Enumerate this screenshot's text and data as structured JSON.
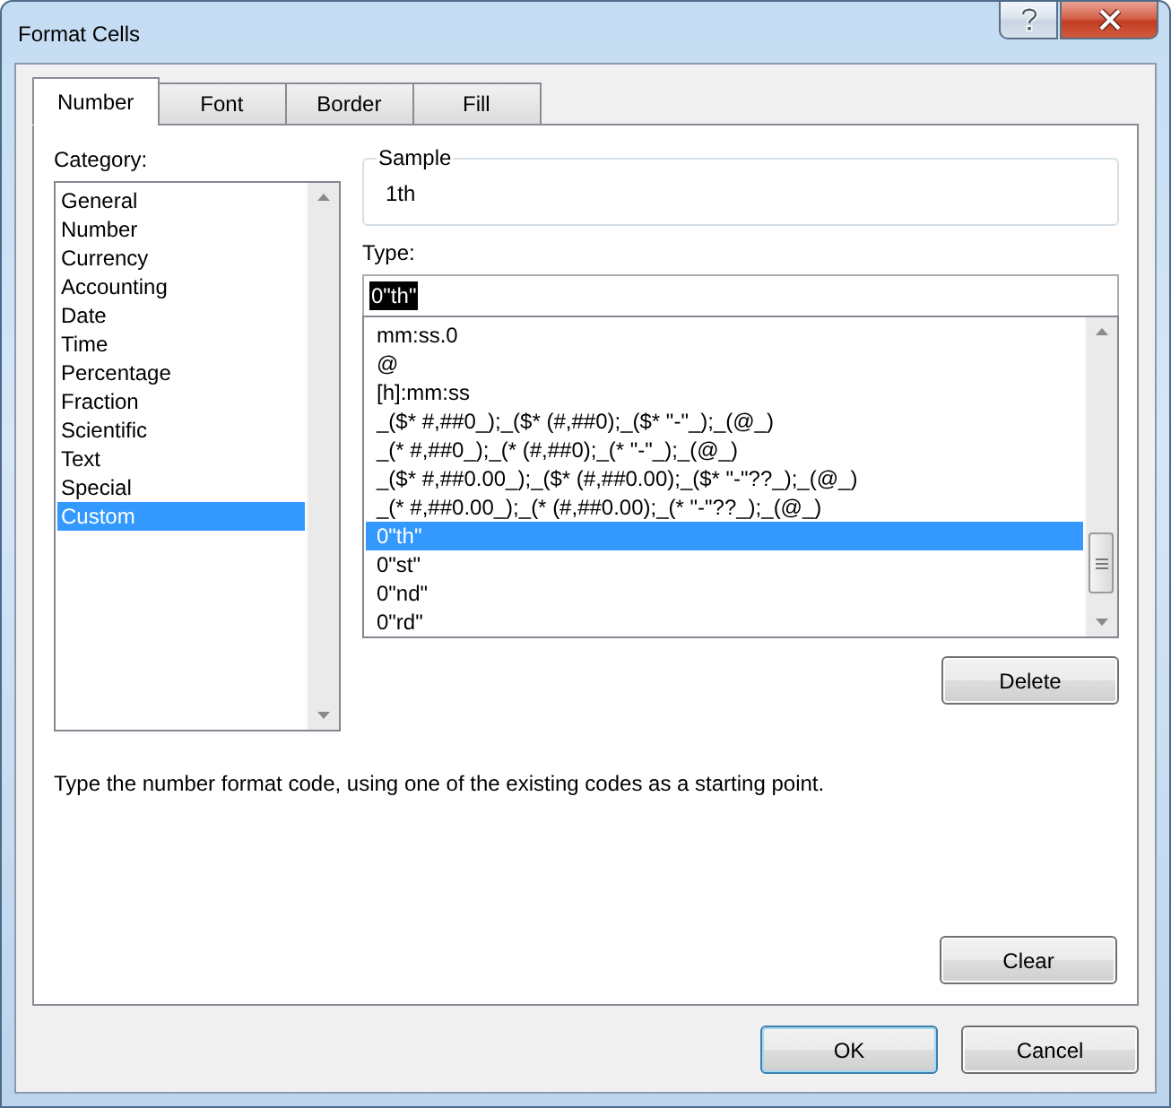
{
  "window": {
    "title": "Format Cells"
  },
  "tabs": [
    {
      "label": "Number",
      "selected": true
    },
    {
      "label": "Font",
      "selected": false
    },
    {
      "label": "Border",
      "selected": false
    },
    {
      "label": "Fill",
      "selected": false
    }
  ],
  "category": {
    "label": "Category:",
    "items": [
      {
        "label": "General",
        "selected": false
      },
      {
        "label": "Number",
        "selected": false
      },
      {
        "label": "Currency",
        "selected": false
      },
      {
        "label": "Accounting",
        "selected": false
      },
      {
        "label": "Date",
        "selected": false
      },
      {
        "label": "Time",
        "selected": false
      },
      {
        "label": "Percentage",
        "selected": false
      },
      {
        "label": "Fraction",
        "selected": false
      },
      {
        "label": "Scientific",
        "selected": false
      },
      {
        "label": "Text",
        "selected": false
      },
      {
        "label": "Special",
        "selected": false
      },
      {
        "label": "Custom",
        "selected": true
      }
    ]
  },
  "sample": {
    "label": "Sample",
    "value": "1th"
  },
  "type": {
    "label": "Type:",
    "value": "0\"th\"",
    "value_highlighted": true,
    "items": [
      {
        "label": "mm:ss.0",
        "selected": false
      },
      {
        "label": "@",
        "selected": false
      },
      {
        "label": "[h]:mm:ss",
        "selected": false
      },
      {
        "label": "_($* #,##0_);_($* (#,##0);_($* \"-\"_);_(@_)",
        "selected": false
      },
      {
        "label": "_(* #,##0_);_(* (#,##0);_(* \"-\"_);_(@_)",
        "selected": false
      },
      {
        "label": "_($* #,##0.00_);_($* (#,##0.00);_($* \"-\"??_);_(@_)",
        "selected": false
      },
      {
        "label": "_(* #,##0.00_);_(* (#,##0.00);_(* \"-\"??_);_(@_)",
        "selected": false
      },
      {
        "label": "0\"th\"",
        "selected": true
      },
      {
        "label": "0\"st\"",
        "selected": false
      },
      {
        "label": "0\"nd\"",
        "selected": false
      },
      {
        "label": "0\"rd\"",
        "selected": false
      }
    ]
  },
  "delete_button": "Delete",
  "description": "Type the number format code, using one of the existing codes as a starting point.",
  "clear_button": "Clear",
  "footer_buttons": [
    {
      "label": "OK",
      "default": true
    },
    {
      "label": "Cancel",
      "default": false
    }
  ]
}
